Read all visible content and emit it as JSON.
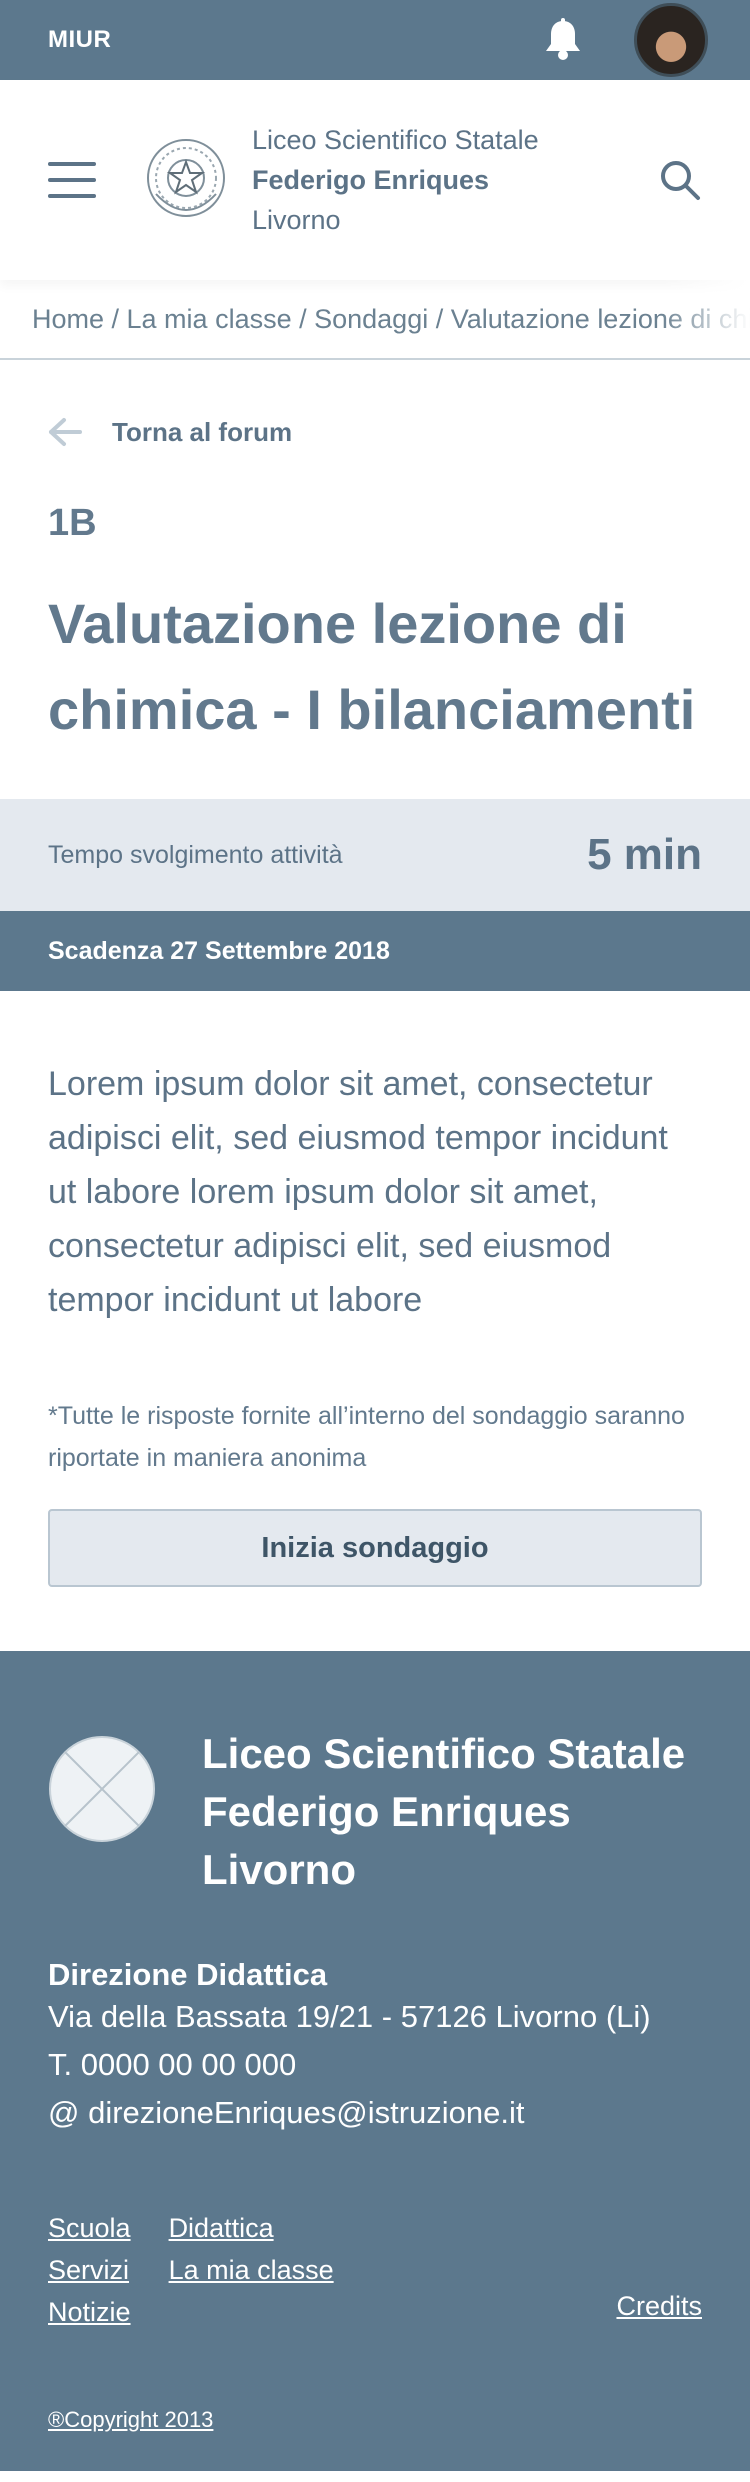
{
  "topbar": {
    "brand": "MIUR",
    "bell_icon": "bell-icon",
    "avatar_icon": "user-avatar"
  },
  "header": {
    "menu_icon": "hamburger-menu-icon",
    "emblem_icon": "italian-republic-emblem",
    "school_line1": "Liceo Scientifico Statale",
    "school_line2": "Federigo Enriques",
    "school_line3": "Livorno",
    "search_icon": "search-icon"
  },
  "breadcrumb": "Home / La mia classe / Sondaggi / Valutazione lezione di chimica",
  "back": {
    "label": "Torna al forum",
    "icon": "arrow-left-icon"
  },
  "survey": {
    "class_code": "1B",
    "title_line1": "Valutazione lezione di",
    "title_line2": "chimica - I bilanciamenti",
    "time_label": "Tempo svolgimento attività",
    "time_value": "5 min",
    "deadline": "Scadenza 27 Settembre 2018",
    "description": "Lorem ipsum dolor sit amet, consectetur adipisci elit, sed eiusmod tempor incidunt ut labore lorem ipsum dolor sit amet, consectetur adipisci elit, sed eiusmod tempor incidunt ut labore",
    "note": "*Tutte le risposte fornite all’interno del sondaggio saranno riportate in maniera anonima",
    "start_button": "Inizia sondaggio"
  },
  "footer": {
    "logo_icon": "placeholder-logo",
    "name_line1": "Liceo Scientifico Statale",
    "name_line2": "Federigo Enriques",
    "name_line3": "Livorno",
    "direction_title": "Direzione Didattica",
    "address": "Via della Bassata 19/21 - 57126 Livorno (Li)",
    "phone": "T. 0000 00 00 000",
    "email": "@ direzioneEnriques@istruzione.it",
    "links_col1": [
      "Scuola",
      "Servizi",
      "Notizie"
    ],
    "links_col2": [
      "Didattica",
      "La mia classe"
    ],
    "credits": "Credits",
    "copyright": "®Copyright 2013"
  },
  "colors": {
    "primary": "#5c788d",
    "light": "#e4e9ef",
    "text": "#5c7387"
  }
}
